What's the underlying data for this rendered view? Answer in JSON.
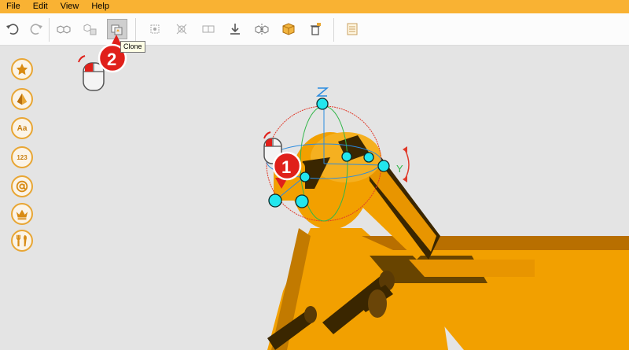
{
  "menu": {
    "file": "File",
    "edit": "Edit",
    "view": "View",
    "help": "Help"
  },
  "toolbar": {
    "tooltip": "Clone"
  },
  "sidebar": {
    "text_label": "Aa",
    "number_label": "123"
  },
  "steps": {
    "step1": "1",
    "step2": "2"
  },
  "gizmo": {
    "z_label": "Z",
    "y_label": "Y"
  },
  "colors": {
    "menubar": "#f9b233",
    "model": "#f2a000",
    "model_shade": "#b86f00",
    "dark": "#3a2600",
    "handle": "#22e6ee",
    "marker": "#e0201a"
  }
}
